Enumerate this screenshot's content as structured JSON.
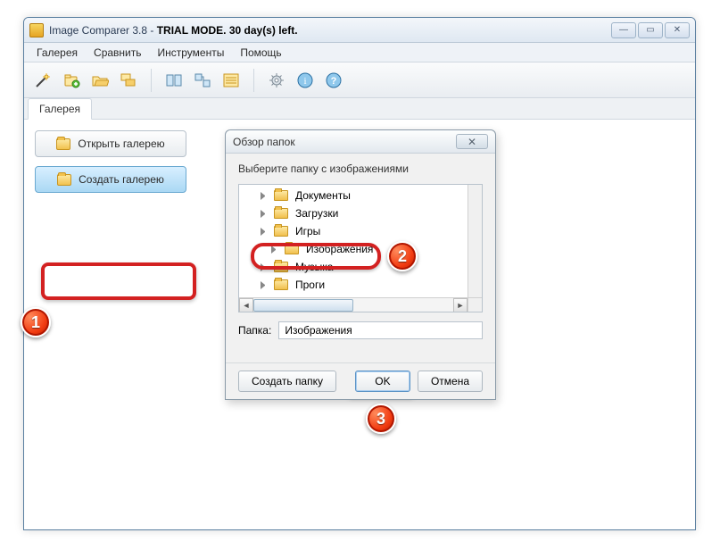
{
  "window": {
    "title_prefix": "Image Comparer 3.8 - ",
    "title_bold": "TRIAL MODE. 30 day(s) left."
  },
  "menus": [
    "Галерея",
    "Сравнить",
    "Инструменты",
    "Помощь"
  ],
  "tab": {
    "label": "Галерея"
  },
  "side": {
    "open_label": "Открыть галерею",
    "create_label": "Создать галерею"
  },
  "modal": {
    "title": "Обзор папок",
    "prompt": "Выберите папку с изображениями",
    "folder_label": "Папка:",
    "folder_value": "Изображения",
    "btn_create": "Создать папку",
    "btn_ok": "OK",
    "btn_cancel": "Отмена",
    "tree": [
      {
        "label": "Документы"
      },
      {
        "label": "Загрузки"
      },
      {
        "label": "Игры"
      },
      {
        "label": "Изображения",
        "selected": true
      },
      {
        "label": "Музыка"
      },
      {
        "label": "Проги"
      }
    ]
  },
  "badges": {
    "b1": "1",
    "b2": "2",
    "b3": "3"
  }
}
